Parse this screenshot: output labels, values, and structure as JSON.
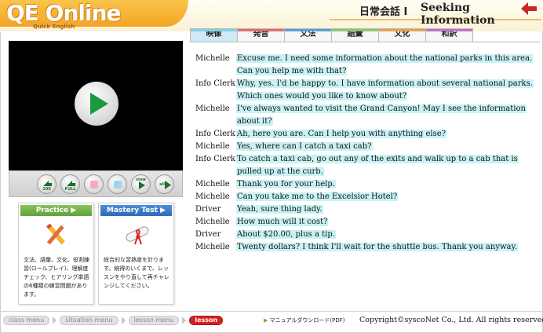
{
  "header": {
    "logo": "QE Online",
    "logo_sub": "Quick English",
    "lesson_jp": "日常会話 I",
    "lesson_en": "Seeking Information"
  },
  "tabs": [
    {
      "label": "映像",
      "active": true
    },
    {
      "label": "発音",
      "active": false
    },
    {
      "label": "文法",
      "active": false
    },
    {
      "label": "語彙",
      "active": false
    },
    {
      "label": "文化",
      "active": false
    },
    {
      "label": "和訳",
      "active": false
    }
  ],
  "controls": {
    "c1": "100",
    "c2": "FULL",
    "c5": "slow",
    "c6": "all"
  },
  "practice": {
    "title": "Practice",
    "text": "文法、語彙、文化、役割練習(ロールプレイ)、理解度チェック、ヒアリング単語の6種類の練習問題があります。"
  },
  "mastery": {
    "title": "Mastery Test",
    "text": "総合的な習熟度を計ります。納得のいくまで、レッスンをやり直して再チャレンジしてください。"
  },
  "dialogue": [
    {
      "speaker": "Michelle",
      "text": "Excuse me. I need some information about the national parks in this area. Can you help me with that?"
    },
    {
      "speaker": "Info Clerk",
      "text": "Why, yes. I'd be happy to. I have information about several national parks. Which ones would you like to know about?"
    },
    {
      "speaker": "Michelle",
      "text": "I've always wanted to visit the Grand Canyon! May I see the information about it?"
    },
    {
      "speaker": "Info Clerk",
      "text": "Ah, here you are. Can I help you with anything else?"
    },
    {
      "speaker": "Michelle",
      "text": "Yes, where can I catch a taxi cab?"
    },
    {
      "speaker": "Info Clerk",
      "text": "To catch a taxi cab, go out any of the exits and walk up to a cab that is pulled up at the curb."
    },
    {
      "speaker": "Michelle",
      "text": "Thank you for your help."
    },
    {
      "speaker": "Michelle",
      "text": "Can you take me to the Excelsior Hotel?"
    },
    {
      "speaker": "Driver",
      "text": "Yeah, sure thing lady."
    },
    {
      "speaker": "Michelle",
      "text": "How much will it cost?"
    },
    {
      "speaker": "Driver",
      "text": "About $20.00, plus a tip."
    },
    {
      "speaker": "Michelle",
      "text": "Twenty dollars? I think I'll wait for the shuttle bus. Thank you anyway."
    }
  ],
  "footer": {
    "crumbs": [
      {
        "label": "class menu",
        "current": false
      },
      {
        "label": "situation menu",
        "current": false
      },
      {
        "label": "lesson menu",
        "current": false
      },
      {
        "label": "lesson",
        "current": true
      }
    ],
    "manual": "マニュアルダウンロード(PDF)",
    "copyright": "Copyright©syscoNet Co., Ltd. All rights reserved."
  }
}
